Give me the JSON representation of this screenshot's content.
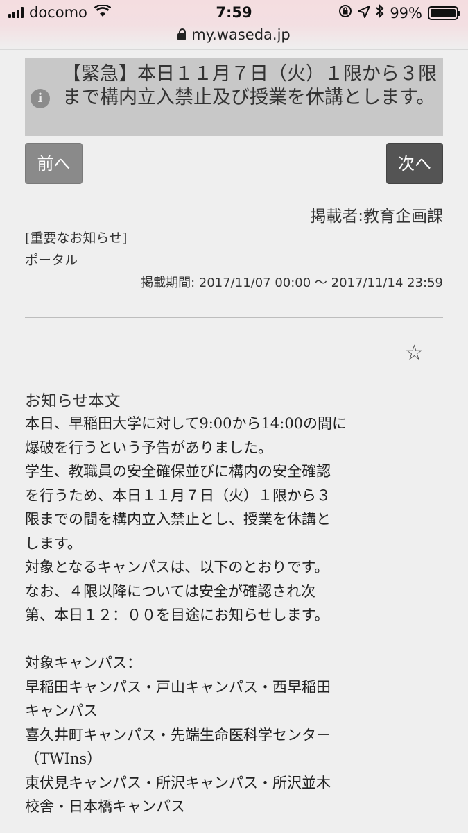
{
  "status_bar": {
    "carrier": "docomo",
    "time": "7:59",
    "battery": "99%",
    "battery_level": 0.99
  },
  "browser": {
    "url": "my.waseda.jp"
  },
  "alert": {
    "text": "【緊急】本日１１月７日（火）１限から３限まで構内立入禁止及び授業を休講とします。"
  },
  "nav": {
    "prev_label": "前へ",
    "next_label": "次へ"
  },
  "notice": {
    "author": "掲載者:教育企画課",
    "category": "[重要なお知らせ]",
    "portal": "ポータル",
    "period": "掲載期間: 2017/11/07 00:00 〜 2017/11/14 23:59",
    "body_heading": "お知らせ本文",
    "body_lines": [
      "本日、早稲田大学に対して9:00から14:00の間に",
      "爆破を行うという予告がありました。",
      "学生、教職員の安全確保並びに構内の安全確認",
      "を行うため、本日１１月７日（火）１限から３",
      "限までの間を構内立入禁止とし、授業を休講と",
      "します。",
      "対象となるキャンパスは、以下のとおりです。",
      "なお、４限以降については安全が確認され次",
      "第、本日１２：００を目途にお知らせします。",
      "",
      "対象キャンパス：",
      "早稲田キャンパス・戸山キャンパス・西早稲田",
      "キャンパス",
      "喜久井町キャンパス・先端生命医科学センター",
      "（TWIns）",
      "東伏見キャンパス・所沢キャンパス・所沢並木",
      "校舎・日本橋キャンパス"
    ]
  }
}
